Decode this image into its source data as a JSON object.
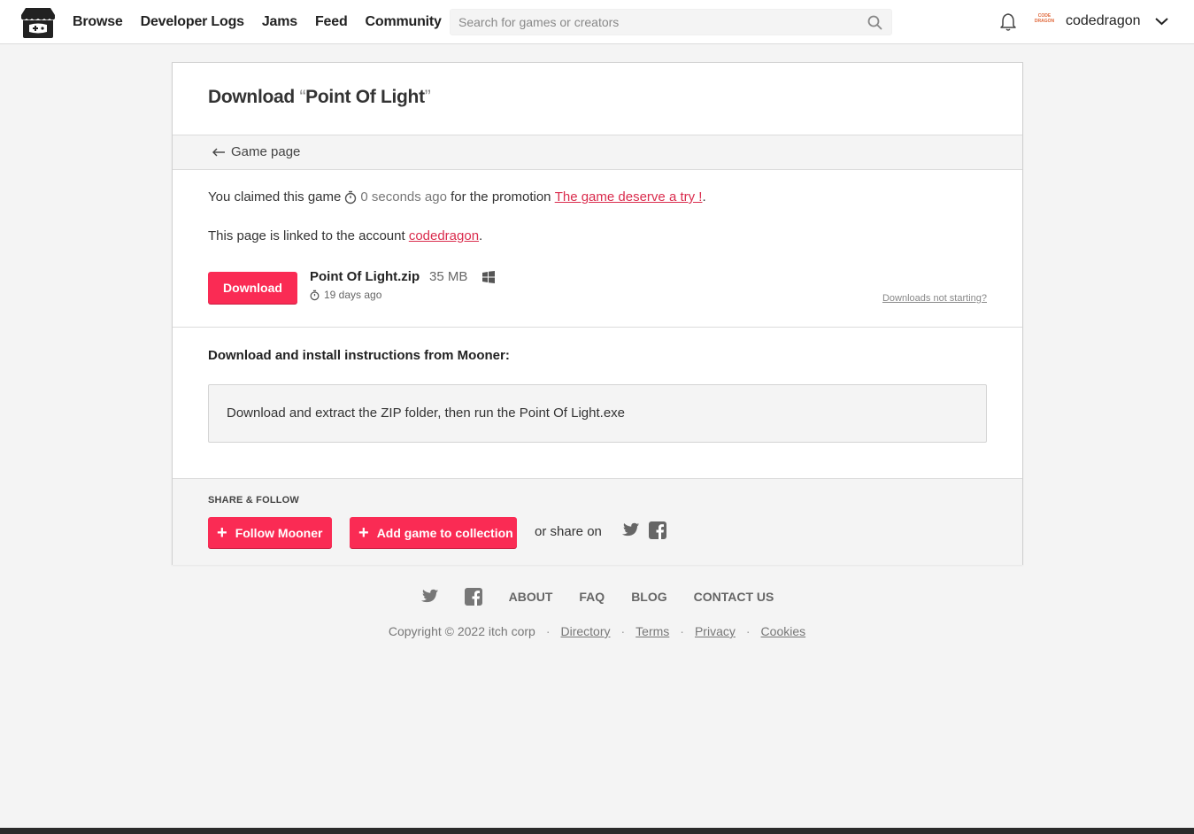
{
  "header": {
    "nav": [
      "Browse",
      "Developer Logs",
      "Jams",
      "Feed",
      "Community"
    ],
    "search_placeholder": "Search for games or creators",
    "avatar_text": "CODE DRAGON",
    "username": "codedragon"
  },
  "card": {
    "title_prefix": "Download ",
    "quote_open": "“",
    "game_name": "Point Of Light",
    "quote_close": "”",
    "back_link": "Game page",
    "claim_prefix": "You claimed this game",
    "claim_time": "0 seconds ago",
    "claim_middle": "for the promotion",
    "promotion_link": "The game deserve a try !",
    "claim_end": ".",
    "linked_prefix": "This page is linked to the account ",
    "linked_account": "codedragon",
    "linked_end": ".",
    "download_button": "Download",
    "file_name": "Point Of Light.zip",
    "file_size": "35 MB",
    "file_age": "19 days ago",
    "downloads_help": "Downloads not starting?",
    "instructions_title": "Download and install instructions from Mooner:",
    "instructions_text": "Download and extract the ZIP folder, then run the Point Of Light.exe"
  },
  "share": {
    "label": "SHARE & FOLLOW",
    "follow_button": "Follow Mooner",
    "collection_button": "Add game to collection",
    "share_on": "or share on"
  },
  "footer": {
    "links": [
      "ABOUT",
      "FAQ",
      "BLOG",
      "CONTACT US"
    ],
    "copyright": "Copyright © 2022 itch corp",
    "legal": [
      "Directory",
      "Terms",
      "Privacy",
      "Cookies"
    ]
  },
  "colors": {
    "accent": "#fa2b54",
    "link": "#da2c4d"
  }
}
